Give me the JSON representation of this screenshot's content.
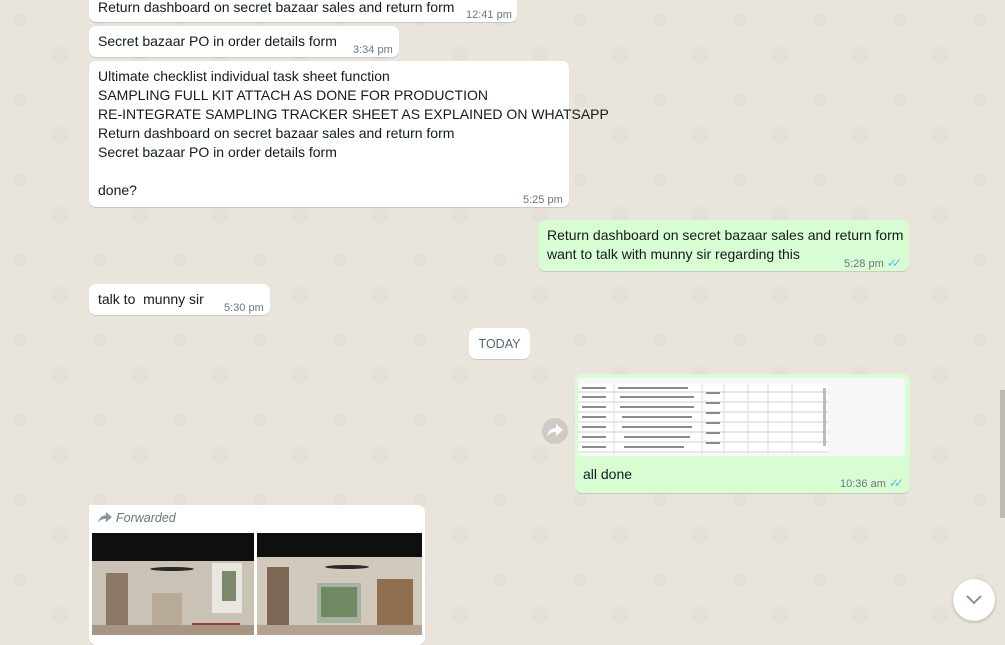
{
  "messages": [
    {
      "text": "Return dashboard on secret bazaar sales and return form",
      "time": "12:41 pm"
    },
    {
      "text": "Secret bazaar PO in order details form",
      "time": "3:34 pm"
    },
    {
      "lines": [
        "Ultimate checklist individual task sheet function",
        "SAMPLING FULL KIT ATTACH AS DONE FOR PRODUCTION",
        "RE-INTEGRATE SAMPLING TRACKER SHEET AS EXPLAINED ON WHATSAPP",
        "Return dashboard on secret bazaar sales and return form",
        "Secret bazaar PO in order details form",
        "",
        "done?"
      ],
      "time": "5:25 pm"
    },
    {
      "lines": [
        "Return dashboard on secret bazaar sales and return form",
        "want to talk with munny sir regarding this"
      ],
      "time": "5:28 pm"
    },
    {
      "text": "talk to  munny sir",
      "time": "5:30 pm"
    }
  ],
  "date_divider": "TODAY",
  "image_message": {
    "caption": "all done",
    "time": "10:36 am"
  },
  "forwarded_message": {
    "label": "Forwarded"
  },
  "icons": {
    "forward": "forward-icon",
    "read_ticks": "double-check-icon",
    "scroll_down": "chevron-down-icon"
  },
  "colors": {
    "incoming": "#ffffff",
    "outgoing": "#d9fdd3",
    "tick": "#53bdeb"
  }
}
